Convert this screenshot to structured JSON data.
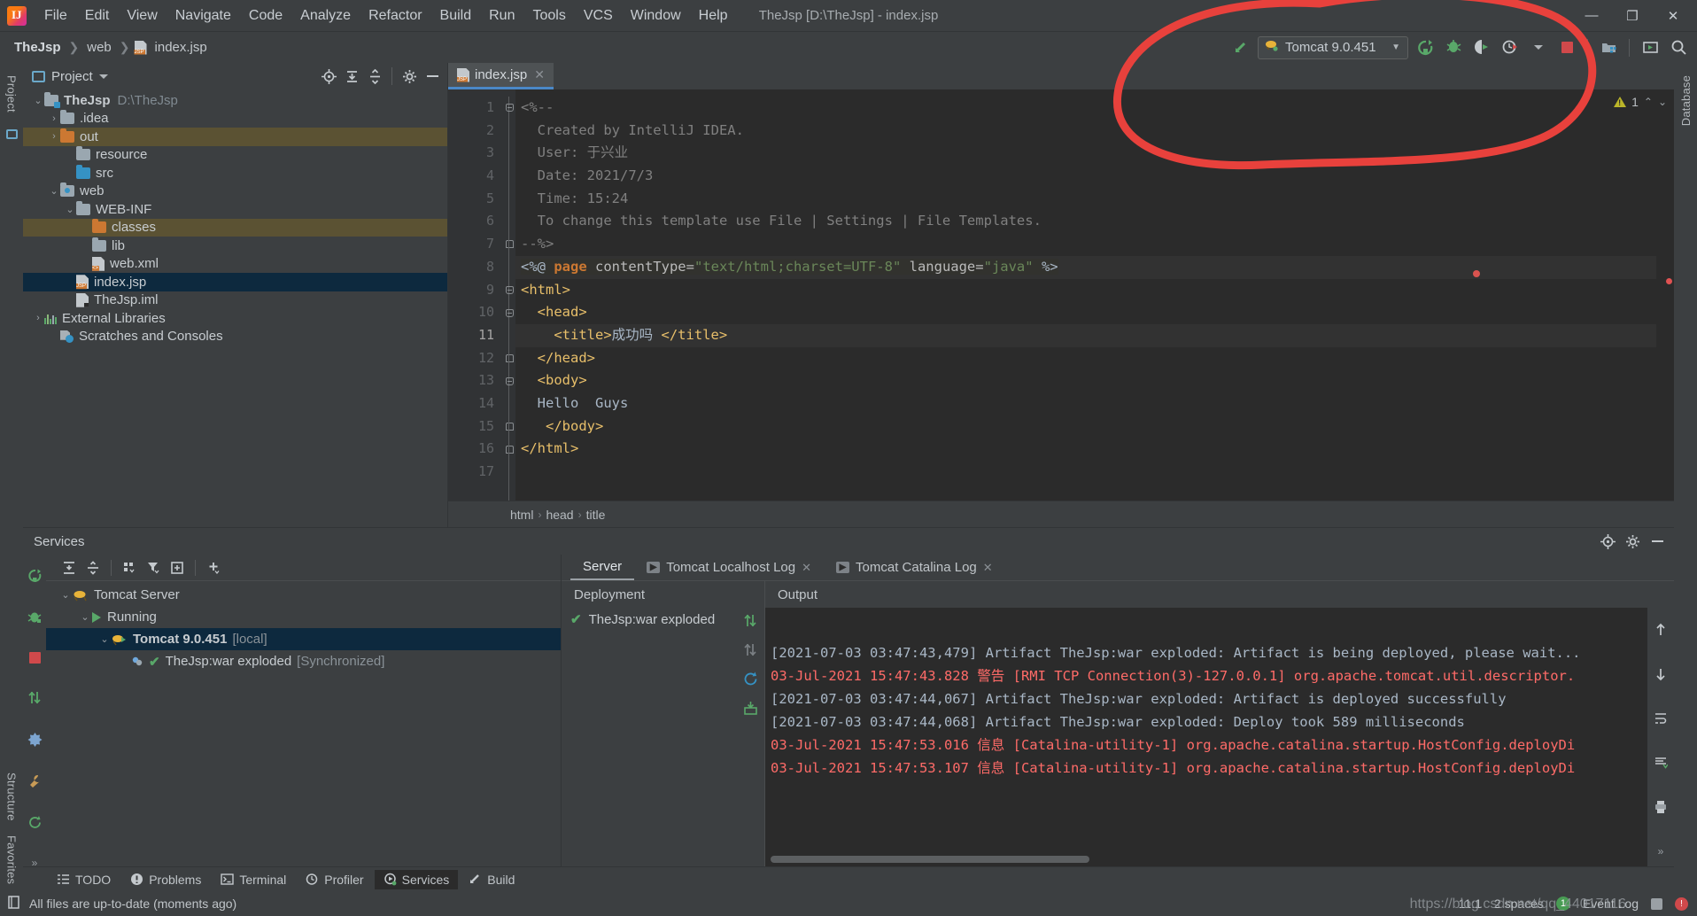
{
  "window": {
    "title": "TheJsp [D:\\TheJsp] - index.jsp",
    "minimize": "—",
    "maximize": "❐",
    "close": "✕"
  },
  "menubar": {
    "items": [
      "File",
      "Edit",
      "View",
      "Navigate",
      "Code",
      "Analyze",
      "Refactor",
      "Build",
      "Run",
      "Tools",
      "VCS",
      "Window",
      "Help"
    ]
  },
  "navbar": {
    "breadcrumbs": [
      "TheJsp",
      "web",
      "index.jsp"
    ],
    "run_config": {
      "label": "Tomcat 9.0.451",
      "icon": "tomcat-icon",
      "dropdown": "▼"
    },
    "icons": [
      "build-hammer-icon",
      "run-icon",
      "debug-icon",
      "run-with-coverage-icon",
      "profiler-icon",
      "stop-icon",
      "project-structure-icon",
      "update-running-app-icon",
      "search-everywhere-icon"
    ]
  },
  "left_rail": {
    "labels": [
      "Project",
      "Structure",
      "Favorites"
    ]
  },
  "right_rail": {
    "labels": [
      "Database"
    ]
  },
  "project_panel": {
    "title": "Project",
    "caret": "▼",
    "header_icons": [
      "select-opened-file-icon",
      "expand-all-icon",
      "collapse-all-icon",
      "settings-gear-icon",
      "hide-icon"
    ],
    "tree": [
      {
        "depth": 0,
        "twist": "v",
        "icon": "module-folder",
        "label": "TheJsp",
        "bold": true,
        "sub": "D:\\TheJsp",
        "state": "normal"
      },
      {
        "depth": 1,
        "twist": ">",
        "icon": "folder-gray",
        "label": ".idea",
        "bold": false,
        "sub": "",
        "state": "normal"
      },
      {
        "depth": 1,
        "twist": ">",
        "icon": "folder-orange",
        "label": "out",
        "bold": false,
        "sub": "",
        "state": "highlight"
      },
      {
        "depth": 2,
        "twist": "",
        "icon": "folder-gray",
        "label": "resource",
        "bold": false,
        "sub": "",
        "state": "normal"
      },
      {
        "depth": 2,
        "twist": "",
        "icon": "folder-blue",
        "label": "src",
        "bold": false,
        "sub": "",
        "state": "normal"
      },
      {
        "depth": 1,
        "twist": "v",
        "icon": "folder-web",
        "label": "web",
        "bold": false,
        "sub": "",
        "state": "normal"
      },
      {
        "depth": 2,
        "twist": "v",
        "icon": "folder-gray",
        "label": "WEB-INF",
        "bold": false,
        "sub": "",
        "state": "normal"
      },
      {
        "depth": 3,
        "twist": "",
        "icon": "folder-orange",
        "label": "classes",
        "bold": false,
        "sub": "",
        "state": "highlight"
      },
      {
        "depth": 3,
        "twist": "",
        "icon": "folder-gray",
        "label": "lib",
        "bold": false,
        "sub": "",
        "state": "normal"
      },
      {
        "depth": 3,
        "twist": "",
        "icon": "file-xml",
        "label": "web.xml",
        "bold": false,
        "sub": "",
        "state": "normal"
      },
      {
        "depth": 2,
        "twist": "",
        "icon": "file-jsp",
        "label": "index.jsp",
        "bold": false,
        "sub": "",
        "state": "selected"
      },
      {
        "depth": 2,
        "twist": "",
        "icon": "file-iml",
        "label": "TheJsp.iml",
        "bold": false,
        "sub": "",
        "state": "normal"
      },
      {
        "depth": 0,
        "twist": ">",
        "icon": "libraries",
        "label": "External Libraries",
        "bold": false,
        "sub": "",
        "state": "normal"
      },
      {
        "depth": 1,
        "twist": "",
        "icon": "scratches",
        "label": "Scratches and Consoles",
        "bold": false,
        "sub": "",
        "state": "normal"
      }
    ]
  },
  "editor": {
    "tab": {
      "label": "index.jsp",
      "icon": "jsp-file-icon",
      "close": "✕"
    },
    "inspection": {
      "warning_count": "1",
      "warn_icon": "warning-triangle-icon",
      "up": "⌃",
      "down": "⌄"
    },
    "line_numbers": [
      "1",
      "2",
      "3",
      "4",
      "5",
      "6",
      "7",
      "8",
      "9",
      "10",
      "11",
      "12",
      "13",
      "14",
      "15",
      "16",
      "17"
    ],
    "current_line": 11,
    "lines": [
      {
        "n": 1,
        "tokens": [
          {
            "t": "<%--",
            "c": "c-cmt"
          }
        ]
      },
      {
        "n": 2,
        "tokens": [
          {
            "t": "  Created by IntelliJ IDEA.",
            "c": "c-cmt"
          }
        ]
      },
      {
        "n": 3,
        "tokens": [
          {
            "t": "  User: 于兴业",
            "c": "c-cmt"
          }
        ]
      },
      {
        "n": 4,
        "tokens": [
          {
            "t": "  Date: 2021/7/3",
            "c": "c-cmt"
          }
        ]
      },
      {
        "n": 5,
        "tokens": [
          {
            "t": "  Time: 15:24",
            "c": "c-cmt"
          }
        ]
      },
      {
        "n": 6,
        "tokens": [
          {
            "t": "  To change this template use File | Settings | File Templates.",
            "c": "c-cmt"
          }
        ]
      },
      {
        "n": 7,
        "tokens": [
          {
            "t": "--%>",
            "c": "c-cmt"
          }
        ]
      },
      {
        "n": 8,
        "tokens": [
          {
            "t": "<%@ ",
            "c": "c-txt"
          },
          {
            "t": "page",
            "c": "c-kw"
          },
          {
            "t": " contentType=",
            "c": "c-attr"
          },
          {
            "t": "\"text/html;charset=UTF-8\"",
            "c": "c-str"
          },
          {
            "t": " language=",
            "c": "c-attr"
          },
          {
            "t": "\"java\"",
            "c": "c-str"
          },
          {
            "t": " %>",
            "c": "c-txt"
          }
        ]
      },
      {
        "n": 9,
        "tokens": [
          {
            "t": "<html>",
            "c": "c-tag"
          }
        ]
      },
      {
        "n": 10,
        "tokens": [
          {
            "t": "  <head>",
            "c": "c-tag"
          }
        ]
      },
      {
        "n": 11,
        "tokens": [
          {
            "t": "    <title>",
            "c": "c-tag"
          },
          {
            "t": "成功吗 ",
            "c": "c-txt"
          },
          {
            "t": "</title>",
            "c": "c-tag"
          }
        ]
      },
      {
        "n": 12,
        "tokens": [
          {
            "t": "  </head>",
            "c": "c-tag"
          }
        ]
      },
      {
        "n": 13,
        "tokens": [
          {
            "t": "  <body>",
            "c": "c-tag"
          }
        ]
      },
      {
        "n": 14,
        "tokens": [
          {
            "t": "  Hello  Guys",
            "c": "c-txt"
          }
        ]
      },
      {
        "n": 15,
        "tokens": [
          {
            "t": "   </body>",
            "c": "c-tag"
          }
        ]
      },
      {
        "n": 16,
        "tokens": [
          {
            "t": "</html>",
            "c": "c-tag"
          }
        ]
      },
      {
        "n": 17,
        "tokens": [
          {
            "t": "",
            "c": "c-txt"
          }
        ]
      }
    ],
    "breadcrumbs": [
      "html",
      "head",
      "title"
    ],
    "breadcrumb_sep": "›"
  },
  "services": {
    "title": "Services",
    "header_icons": [
      "locate-icon",
      "settings-gear-icon",
      "hide-icon"
    ],
    "toolbar_icons": [
      "rerun-icon",
      "expand-all-icon",
      "collapse-all-icon",
      "group-by-icon",
      "filter-icon",
      "add-tab-icon",
      "add-service-icon"
    ],
    "rail_icons": [
      "rerun-icon",
      "debug-icon",
      "stop-icon",
      "redeploy-icon",
      "settings-icon",
      "wrench-icon",
      "refresh-icon",
      "more-icon"
    ],
    "tree": [
      {
        "depth": 0,
        "twist": "v",
        "icon": "tomcat-icon",
        "label": "Tomcat Server",
        "sub": "",
        "bold": false,
        "state": "normal"
      },
      {
        "depth": 1,
        "twist": "v",
        "icon": "running-icon",
        "label": "Running",
        "sub": "",
        "bold": false,
        "state": "normal"
      },
      {
        "depth": 2,
        "twist": "v",
        "icon": "tomcat-run-icon",
        "label": "Tomcat 9.0.451",
        "sub": "[local]",
        "bold": true,
        "state": "selected"
      },
      {
        "depth": 3,
        "twist": "",
        "icon": "artifact-ok-icon",
        "label": "TheJsp:war exploded",
        "sub": "[Synchronized]",
        "bold": false,
        "state": "normal"
      }
    ],
    "tabs": [
      {
        "label": "Server",
        "active": true,
        "icon": "",
        "closable": false
      },
      {
        "label": "Tomcat Localhost Log",
        "active": false,
        "icon": "log-icon",
        "closable": true
      },
      {
        "label": "Tomcat Catalina Log",
        "active": false,
        "icon": "log-icon",
        "closable": true
      }
    ],
    "tab_close": "✕",
    "deployment": {
      "header": "Deployment",
      "items": [
        {
          "label": "TheJsp:war exploded",
          "status": "ok"
        }
      ],
      "actions": [
        "deploy-icon",
        "undeploy-icon",
        "redeploy-icon",
        "restart-icon"
      ]
    },
    "output": {
      "header": "Output",
      "lines": [
        {
          "text": "[2021-07-03 03:47:43,479] Artifact TheJsp:war exploded: Artifact is being deployed, please wait...",
          "color": "gray"
        },
        {
          "text": "03-Jul-2021 15:47:43.828 警告 [RMI TCP Connection(3)-127.0.0.1] org.apache.tomcat.util.descriptor.",
          "color": "red"
        },
        {
          "text": "[2021-07-03 03:47:44,067] Artifact TheJsp:war exploded: Artifact is deployed successfully",
          "color": "gray"
        },
        {
          "text": "[2021-07-03 03:47:44,068] Artifact TheJsp:war exploded: Deploy took 589 milliseconds",
          "color": "gray"
        },
        {
          "text": "03-Jul-2021 15:47:53.016 信息 [Catalina-utility-1] org.apache.catalina.startup.HostConfig.deployDi",
          "color": "red"
        },
        {
          "text": "03-Jul-2021 15:47:53.107 信息 [Catalina-utility-1] org.apache.catalina.startup.HostConfig.deployDi",
          "color": "red"
        }
      ],
      "rail_icons": [
        "scroll-up-icon",
        "scroll-down-icon",
        "soft-wrap-icon",
        "scroll-to-end-icon",
        "print-icon",
        "more-icon"
      ]
    }
  },
  "toolwindow_bar": {
    "items": [
      {
        "label": "TODO",
        "icon": "todo-icon",
        "active": false
      },
      {
        "label": "Problems",
        "icon": "problems-icon",
        "active": false
      },
      {
        "label": "Terminal",
        "icon": "terminal-icon",
        "active": false
      },
      {
        "label": "Profiler",
        "icon": "profiler-icon",
        "active": false
      },
      {
        "label": "Services",
        "icon": "services-icon",
        "active": true
      },
      {
        "label": "Build",
        "icon": "build-icon",
        "active": false
      }
    ]
  },
  "statusbar": {
    "icon": "file-status-icon",
    "message": "All files are up-to-date (moments ago)",
    "position": "11:1",
    "indent": "2 spaces",
    "event_log": "Event Log",
    "event_count": "1"
  },
  "watermark": "https://blog.csdn.net/qq_44017116",
  "colors": {
    "background": "#3c3f41",
    "editor_bg": "#2b2b2b",
    "selection": "#0d293e",
    "accent_green": "#59a869",
    "accent_red": "#ff6b68",
    "annotation_red": "#e8413c",
    "tab_underline": "#4a88c7"
  }
}
